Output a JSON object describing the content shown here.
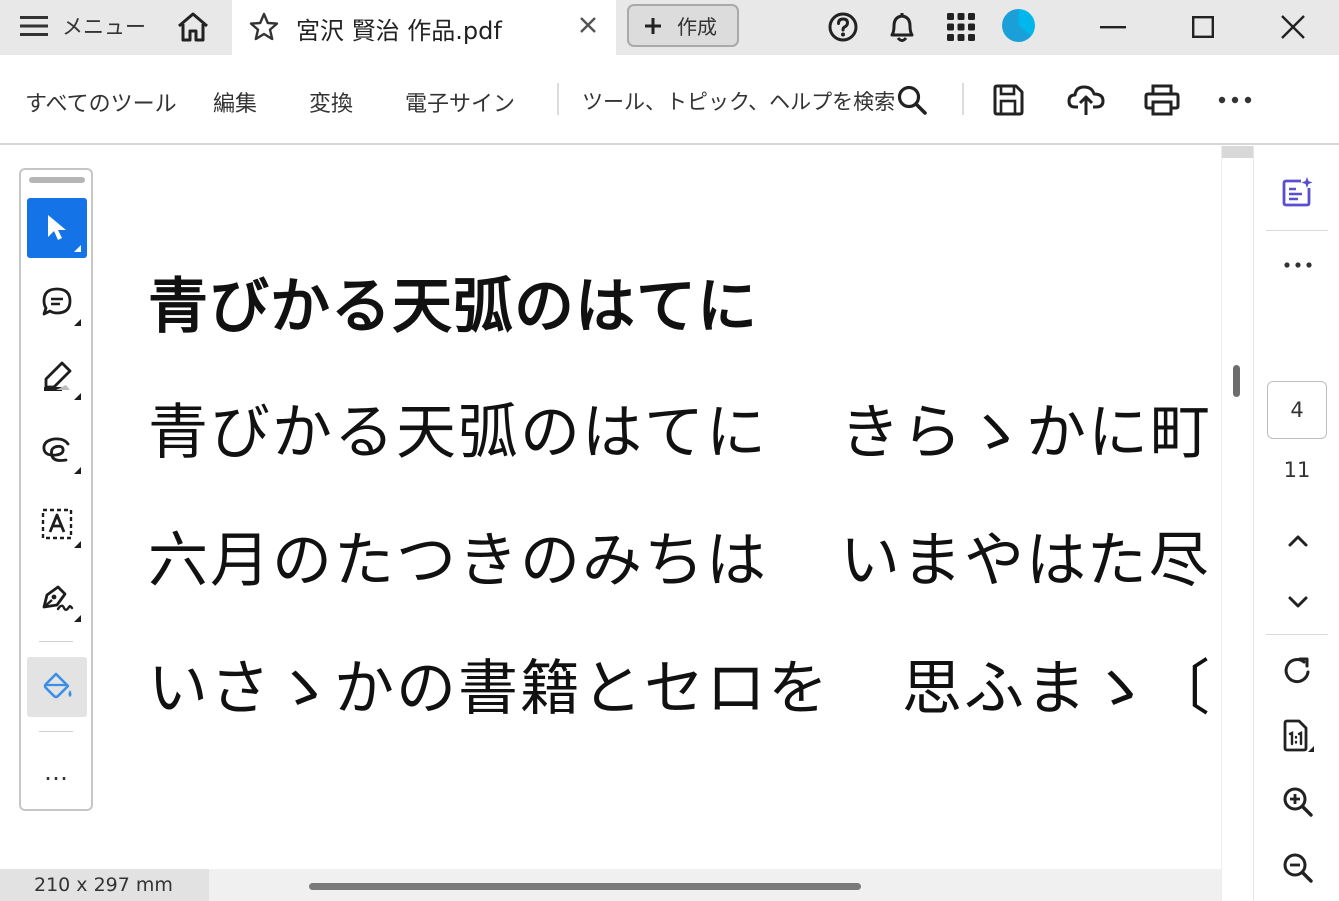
{
  "tabbar": {
    "menu_label": "メニュー",
    "doc_tab_title": "宮沢 賢治 作品.pdf",
    "create_label": "作成",
    "avatar_color": "#00b7eb"
  },
  "toolbar": {
    "links": [
      "すべてのツール",
      "編集",
      "変換",
      "電子サイン"
    ],
    "search_label": "ツール、トピック、ヘルプを検索"
  },
  "left_tools": {
    "active_color": "#1473e6",
    "more_label": "…"
  },
  "document": {
    "heading": "青びかる天弧のはてに",
    "lines": [
      [
        "青びかる天弧のはてに",
        "きらゝかに町"
      ],
      [
        "六月のたつきのみちは",
        "いまやはた尽"
      ],
      [
        "いさゝかの書籍とセロを",
        "思ふまゝ〔"
      ]
    ]
  },
  "right_rail": {
    "current_page": "4",
    "total_pages": "11",
    "accent_color": "#5a4fcf"
  },
  "status": {
    "page_size": "210 x 297 mm"
  }
}
